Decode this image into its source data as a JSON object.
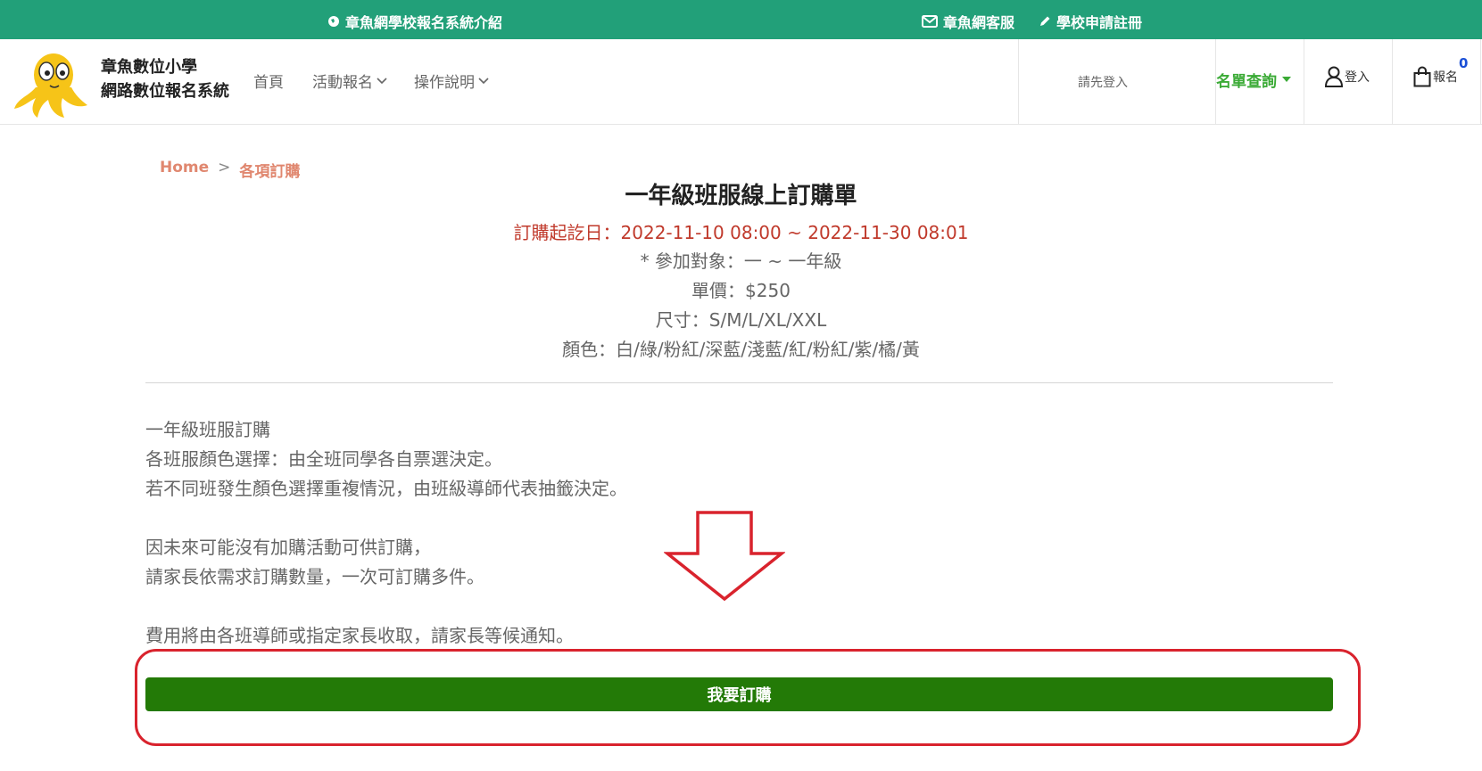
{
  "topbar": {
    "intro_link": "章魚網學校報名系統介紹",
    "support_link": "章魚網客服",
    "register_link": "學校申請註冊",
    "bg_color": "#22a079"
  },
  "header": {
    "site_line1": "章魚數位小學",
    "site_line2": "網路數位報名系統",
    "nav": [
      "首頁",
      "活動報名",
      "操作說明"
    ],
    "login_hint": "請先登入",
    "query_label": "名單查詢",
    "login_label": "登入",
    "cart_label": "報名",
    "cart_count": "0"
  },
  "breadcrumb": {
    "home": "Home",
    "separator": ">",
    "current": "各項訂購"
  },
  "order": {
    "title": "一年級班服線上訂購單",
    "period": "訂購起訖日：2022-11-10 08:00 ~ 2022-11-30 08:01",
    "target": "* 參加對象：一 ~ 一年級",
    "price": "單價：$250",
    "sizes": "尺寸：S/M/L/XL/XXL",
    "colors": "顏色：白/綠/粉紅/深藍/淺藍/紅/粉紅/紫/橘/黃"
  },
  "description": [
    "一年級班服訂購",
    "各班服顏色選擇：由全班同學各自票選決定。",
    "若不同班發生顏色選擇重複情況，由班級導師代表抽籤決定。",
    "因未來可能沒有加購活動可供訂購，",
    "請家長依需求訂購數量，一次可訂購多件。",
    "費用將由各班導師或指定家長收取，請家長等候通知。"
  ],
  "order_button": "我要訂購",
  "colors": {
    "brand_green": "#22a079",
    "button_green": "#237a07",
    "alert_red": "#d9232d",
    "query_green": "#3aaa35"
  }
}
